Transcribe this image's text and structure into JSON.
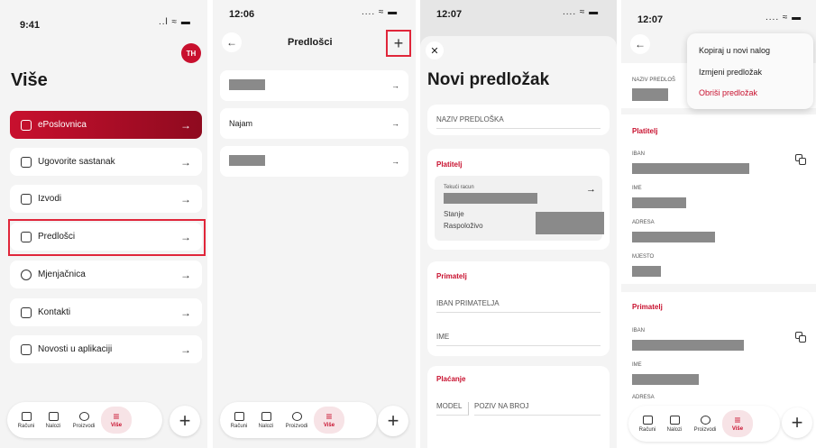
{
  "screen1": {
    "time": "9:41",
    "signal": "..l ≈ ▬",
    "avatar": "TH",
    "title": "Više",
    "items": [
      {
        "label": "ePoslovnica"
      },
      {
        "label": "Ugovorite sastanak"
      },
      {
        "label": "Izvodi"
      },
      {
        "label": "Predlošci"
      },
      {
        "label": "Mjenjačnica"
      },
      {
        "label": "Kontakti"
      },
      {
        "label": "Novosti u aplikaciji"
      }
    ],
    "tabs": [
      "Računi",
      "Nalozi",
      "Proizvodi",
      "Više"
    ]
  },
  "screen2": {
    "time": "12:06",
    "signal": ".... ≈ ▬",
    "title": "Predlošci",
    "rows": [
      {
        "label": ""
      },
      {
        "label": "Najam"
      },
      {
        "label": ""
      }
    ],
    "tabs": [
      "Računi",
      "Nalozi",
      "Proizvodi",
      "Više"
    ]
  },
  "screen3": {
    "time": "12:07",
    "signal": ".... ≈ ▬",
    "title": "Novi predložak",
    "name_field": "NAZIV PREDLOŠKA",
    "payer_title": "Platitelj",
    "account_label": "Tekući racun",
    "balance_label": "Stanje",
    "available_label": "Raspoloživo",
    "recipient_title": "Primatelj",
    "iban_field": "IBAN PRIMATELJA",
    "name2_field": "IME",
    "payment_title": "Plaćanje",
    "model_field": "MODEL",
    "reference_field": "POZIV NA BROJ"
  },
  "screen4": {
    "time": "12:07",
    "signal": ".... ≈ ▬",
    "menu": [
      "Kopiraj u novi nalog",
      "Izmjeni predložak",
      "Obriši predložak"
    ],
    "name_label": "NAZIV PREDLOŠ",
    "payer_title": "Platitelj",
    "iban": "IBAN",
    "ime": "IME",
    "adresa": "ADRESA",
    "mjesto": "MJESTO",
    "recipient_title": "Primatelj",
    "tabs": [
      "Računi",
      "Nalozi",
      "Proizvodi",
      "Više"
    ]
  }
}
